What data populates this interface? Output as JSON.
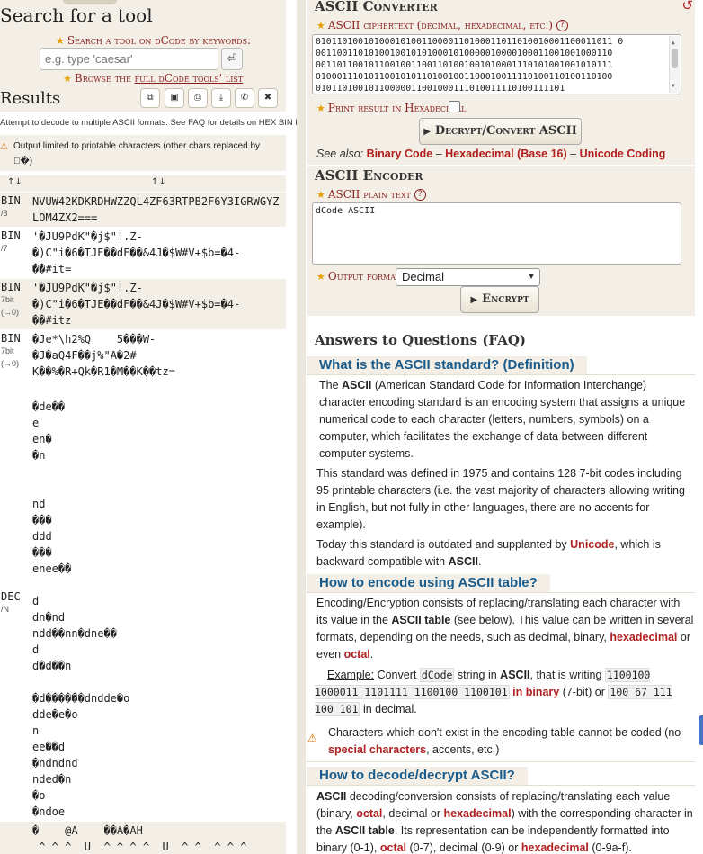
{
  "search": {
    "title": "Search for a tool",
    "label": "Search a tool on dCode by keywords:",
    "placeholder": "e.g. type 'caesar'",
    "go_icon": "enter-icon",
    "browse_prefix": "Browse the ",
    "browse_link": "full dCode tools' list"
  },
  "results": {
    "title": "Results",
    "toolbar_icons": [
      "copy-icon",
      "save-icon",
      "print-icon",
      "download-icon",
      "pin-icon",
      "close-icon"
    ],
    "attempt_note": "Attempt to decode to multiple ASCII formats. See FAQ for details on HEX BIN DEC",
    "warning": "Output limited to printable characters (other chars replaced by",
    "warning_end": "\u0000�)",
    "col1": "↑↓",
    "col2": "↑↓",
    "rows": [
      {
        "type": "BIN",
        "sub": "/8",
        "value": "NVUW42KDKRDHWZZQL4ZF63RTPB2F6Y3IGRWGYZ\nLOM4ZX2===",
        "shade": true
      },
      {
        "type": "BIN",
        "sub": "/7",
        "value": "'�JU9PdK\"�j$\"!.Z-\n�)C\"i�6�TJE��dF��&4J�$W#V+$b=�4-\n��#it=",
        "shade": false
      },
      {
        "type": "BIN",
        "sub": "7bit",
        "sub2": "(→0)",
        "value": "'�JU9PdK\"�j$\"!.Z-\n�)C\"i�6�TJE��dF��&4J�$W#V+$b=�4-\n��#itz",
        "shade": true
      },
      {
        "type": "BIN",
        "sub": "7bit",
        "sub2": "(→0)",
        "value": "�Je*\\h2%Q    5���W-\n�J�aQ4F��j%\"A�2#\nK��%�R+Qk�R1�M��K��tz=",
        "shade": false
      },
      {
        "type": "DEC",
        "sub": "/N",
        "value": "\n�de��\ne\nen�\n�n\n\n\nnd\n���\nddd\n���\nenee��\n\nd\ndn�nd\nndd��nn�dne��\nd\nd�d��n\n\n�d������dndde�o\ndde�e�o\nn\nee��d\n�ndndnd\nnded�n\n�o\n�ndoe",
        "shade": false
      },
      {
        "type": "",
        "sub": "",
        "value": "�    @A    ��A�AH\n ^ ^ ^  U  ^ ^ ^ ^  U  ^ ^  ^ ^ ^",
        "shade": true
      }
    ]
  },
  "converter": {
    "title": "ASCII Converter",
    "ciphertext_label": "ASCII ciphertext (decimal, hexadecimal, etc.)",
    "ciphertext": "01011010010100010100110000110100011011010010001100011011 0\n00110011010100100101010001010000010000100011001001000110\n00110110010110010011001101001001010001110101001001010111\n01000111010110010101101001001100010011110100110100110100\n01011010010110000011001000111010011110100111101",
    "hex_label": "Print result in Hexadecimal",
    "button": "Decrypt/Convert ASCII",
    "see_also_label": "See also:",
    "see_also": [
      "Binary Code",
      "Hexadecimal (Base 16)",
      "Unicode Coding"
    ],
    "refresh_icon": "refresh-icon"
  },
  "encoder": {
    "title": "ASCII Encoder",
    "plaintext_label": "ASCII plain text",
    "plaintext": "dCode ASCII",
    "format_label": "Output format",
    "format_value": "Decimal",
    "button": "Encrypt"
  },
  "faq": {
    "title": "Answers to Questions (FAQ)",
    "q1": "What is the ASCII standard? (Definition)",
    "p1_a": "The ",
    "p1_b": "ASCII",
    "p1_c": " (American Standard Code for Information Interchange) character encoding standard is an encoding system that assigns a unique numerical code to each character (letters, numbers, symbols) on a computer, which facilitates the exchange of data between different computer systems.",
    "p2": "This standard was defined in 1975 and contains 128 7-bit codes including 95 printable characters (i.e. the vast majority of characters allowing writing in English, but not fully in other languages, there are no accents for example).",
    "p3_a": "Today this standard is outdated and supplanted by ",
    "p3_link": "Unicode",
    "p3_b": ", which is backward compatible with ",
    "p3_c": "ASCII",
    "p3_d": ".",
    "q2": "How to encode using ASCII table?",
    "p4_a": "Encoding/Encryption consists of replacing/translating each character with its value in the ",
    "p4_b": "ASCII table",
    "p4_c": " (see below). This value can be written in several formats, depending on the needs, such as decimal, binary, ",
    "p4_link1": "hexadecimal",
    "p4_d": " or even ",
    "p4_link2": "octal",
    "p4_e": ".",
    "ex_label": "Example:",
    "ex_a": " Convert ",
    "ex_code1": "dCode",
    "ex_b": " string in ",
    "ex_c": "ASCII",
    "ex_d": ", that is writing ",
    "ex_code2": "1100100 1000011 1101111 1100100 1100101",
    "ex_e": " in binary",
    "ex_f": " (7-bit) or ",
    "ex_code3": "100 67 111 100 101",
    "ex_g": " in decimal.",
    "warn_a": "Characters which don't exist in the encoding table cannot be coded (no ",
    "warn_link": "special characters",
    "warn_b": ", accents, etc.)",
    "q3": "How to decode/decrypt ASCII?",
    "p5_a": "ASCII",
    "p5_b": " decoding/conversion consists of replacing/translating each value (binary, ",
    "p5_link1": "octal",
    "p5_c": ", decimal or ",
    "p5_link2": "hexadecimal",
    "p5_d": ") with the corresponding character in the ",
    "p5_e": "ASCII table",
    "p5_f": ". Its representation can be independently formatted into binary (0-1), ",
    "p5_link3": "octal",
    "p5_g": " (0-7), decimal (0-9) or ",
    "p5_link4": "hexadecimal",
    "p5_h": " (0-9a-f)."
  },
  "colors": {
    "accent_red": "#b02020",
    "heading_blue": "#1a5c8c",
    "panel_beige": "#f3efe6"
  }
}
